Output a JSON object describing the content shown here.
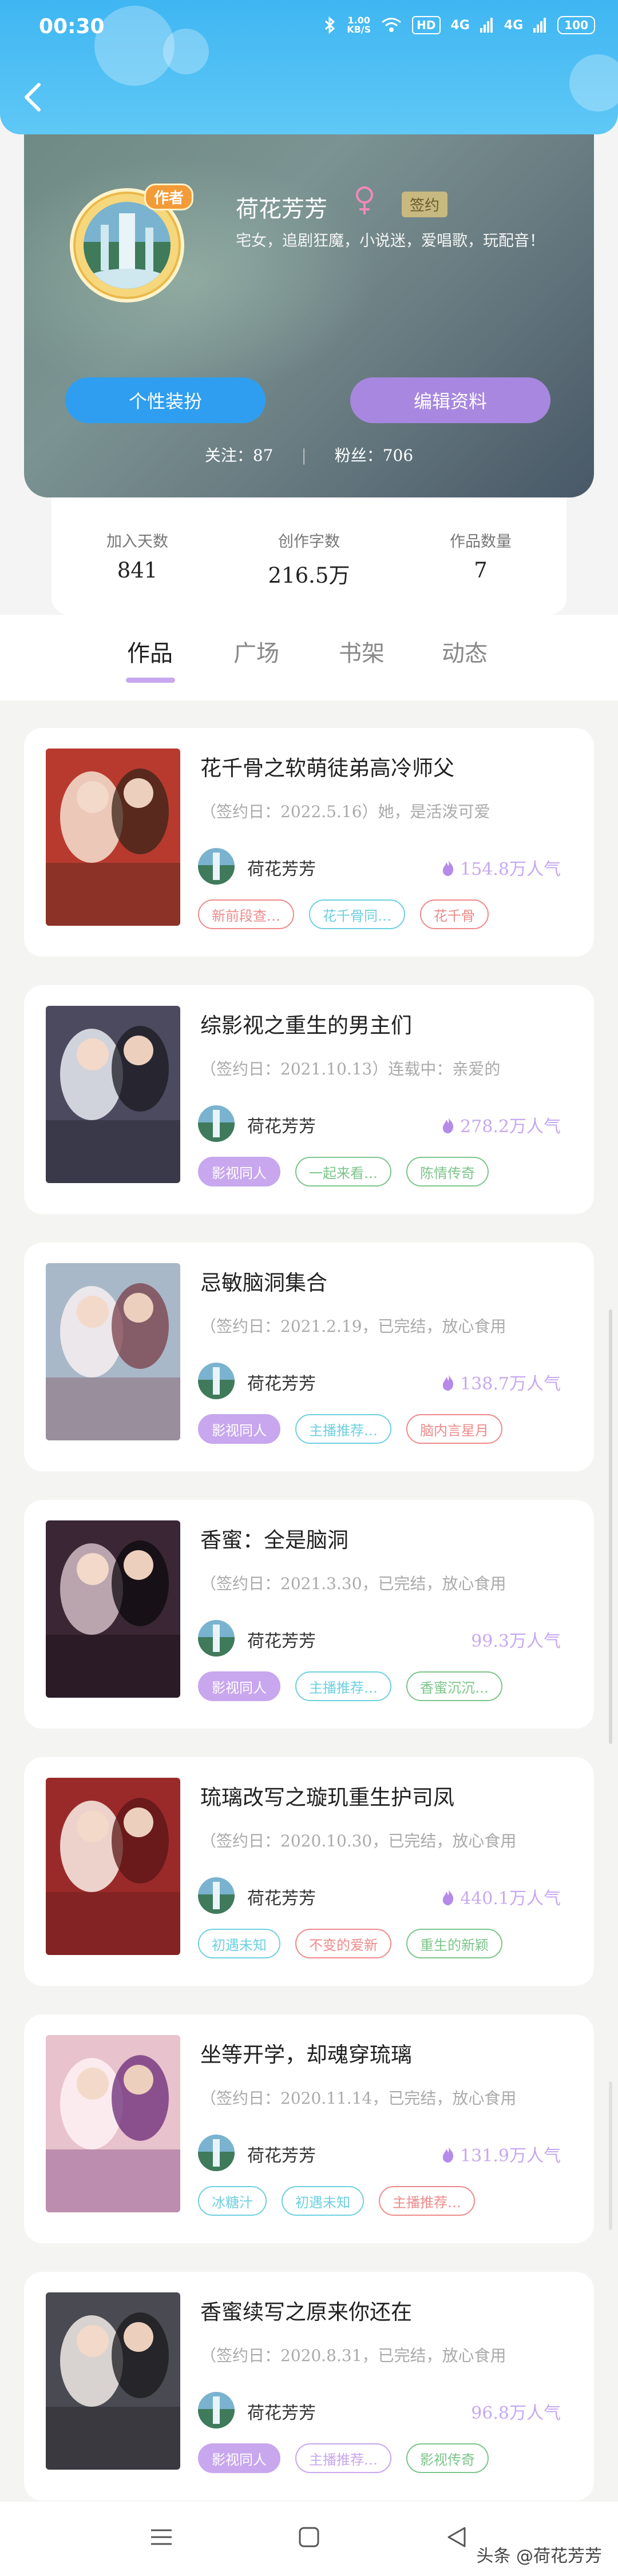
{
  "status": {
    "time": "00:30",
    "speed": "1.00\nKB/S",
    "speed_line1": "1.00",
    "speed_line2": "KB/S",
    "hd": "HD",
    "signal1": "4G",
    "signal2": "4G",
    "battery": "100"
  },
  "profile": {
    "author_tag": "作者",
    "username": "荷花芳芳",
    "signed_badge": "签约",
    "bio": "宅女，追剧狂魔，小说迷，爱唱歌，玩配音！",
    "dress_button": "个性装扮",
    "edit_button": "编辑资料",
    "follow_label": "关注：87",
    "fans_label": "粉丝：706",
    "follow_sep": "|"
  },
  "stats": [
    {
      "label": "加入天数",
      "value": "841"
    },
    {
      "label": "创作字数",
      "value": "216.5万"
    },
    {
      "label": "作品数量",
      "value": "7"
    }
  ],
  "tabs": [
    "作品",
    "广场",
    "书架",
    "动态"
  ],
  "active_tab": "作品",
  "books": [
    {
      "title": "花千骨之软萌徒弟高冷师父",
      "meta": "（签约日：2022.5.16）她，是活泼可爱",
      "author": "荷花芳芳",
      "popularity": "154.8万人气",
      "hot": true,
      "tags": [
        {
          "text": "新前段查…",
          "color": "#ef8a8a",
          "filled": false
        },
        {
          "text": "花千骨同…",
          "color": "#6ed0e0",
          "filled": false
        },
        {
          "text": "花千骨",
          "color": "#ef8a8a",
          "filled": false
        }
      ]
    },
    {
      "title": "综影视之重生的男主们",
      "meta": "（签约日：2021.10.13）连载中：亲爱的",
      "author": "荷花芳芳",
      "popularity": "278.2万人气",
      "hot": true,
      "tags": [
        {
          "text": "影视同人",
          "color": "#c8a7ee",
          "filled": true
        },
        {
          "text": "一起来看…",
          "color": "#7cc58a",
          "filled": false
        },
        {
          "text": "陈情传奇",
          "color": "#7cc58a",
          "filled": false
        }
      ]
    },
    {
      "title": "忌敏脑洞集合",
      "meta": "（签约日：2021.2.19，已完结，放心食用",
      "author": "荷花芳芳",
      "popularity": "138.7万人气",
      "hot": true,
      "tags": [
        {
          "text": "影视同人",
          "color": "#c8a7ee",
          "filled": true
        },
        {
          "text": "主播推荐…",
          "color": "#6ed0e0",
          "filled": false
        },
        {
          "text": "脑内言星月",
          "color": "#ef8a8a",
          "filled": false
        }
      ]
    },
    {
      "title": "香蜜：全是脑洞",
      "meta": "（签约日：2021.3.30，已完结，放心食用",
      "author": "荷花芳芳",
      "popularity": "99.3万人气",
      "hot": false,
      "tags": [
        {
          "text": "影视同人",
          "color": "#c8a7ee",
          "filled": true
        },
        {
          "text": "主播推荐…",
          "color": "#6ed0e0",
          "filled": false
        },
        {
          "text": "香蜜沉沉…",
          "color": "#7cc58a",
          "filled": false
        }
      ]
    },
    {
      "title": "琉璃改写之璇玑重生护司凤",
      "meta": "（签约日：2020.10.30，已完结，放心食用",
      "author": "荷花芳芳",
      "popularity": "440.1万人气",
      "hot": true,
      "tags": [
        {
          "text": "初遇未知",
          "color": "#6ed0e0",
          "filled": false
        },
        {
          "text": "不变的爱新",
          "color": "#ef8a8a",
          "filled": false
        },
        {
          "text": "重生的新颖",
          "color": "#7cc58a",
          "filled": false
        }
      ]
    },
    {
      "title": "坐等开学，却魂穿琉璃",
      "meta": "（签约日：2020.11.14，已完结，放心食用",
      "author": "荷花芳芳",
      "popularity": "131.9万人气",
      "hot": true,
      "tags": [
        {
          "text": "冰糖汁",
          "color": "#6ed0e0",
          "filled": false
        },
        {
          "text": "初遇未知",
          "color": "#6ed0e0",
          "filled": false
        },
        {
          "text": "主播推荐…",
          "color": "#ef8a8a",
          "filled": false
        }
      ]
    },
    {
      "title": "香蜜续写之原来你还在",
      "meta": "（签约日：2020.8.31，已完结，放心食用",
      "author": "荷花芳芳",
      "popularity": "96.8万人气",
      "hot": false,
      "tags": [
        {
          "text": "影视同人",
          "color": "#c8a7ee",
          "filled": true
        },
        {
          "text": "主播推荐…",
          "color": "#c8a7ee",
          "filled": false
        },
        {
          "text": "影视传奇",
          "color": "#7cc58a",
          "filled": false
        }
      ]
    }
  ],
  "watermark": "头条 @荷花芳芳",
  "colors": {
    "header": "#3fb6f2",
    "accent_purple": "#c8a7ee",
    "dress_btn": "#2f9ef0",
    "edit_btn": "#a887e0"
  }
}
